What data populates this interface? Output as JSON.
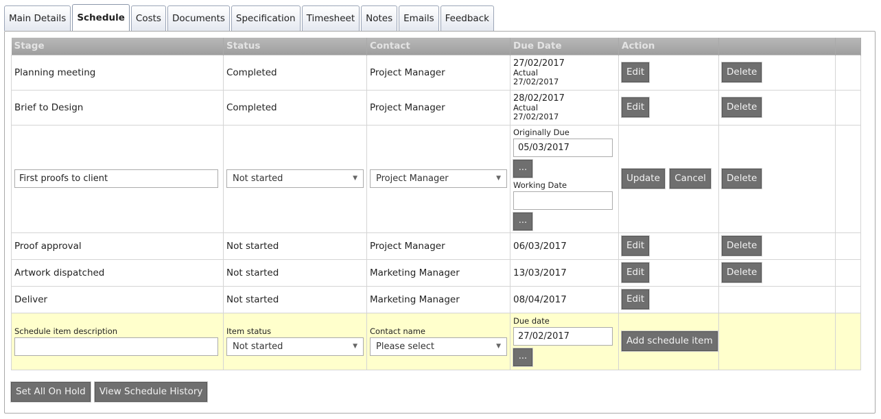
{
  "tabs": [
    "Main Details",
    "Schedule",
    "Costs",
    "Documents",
    "Specification",
    "Timesheet",
    "Notes",
    "Emails",
    "Feedback"
  ],
  "active_tab": "Schedule",
  "table": {
    "headers": {
      "stage": "Stage",
      "status": "Status",
      "contact": "Contact",
      "due_date": "Due Date",
      "action": "Action"
    },
    "rows": [
      {
        "stage": "Planning meeting",
        "status": "Completed",
        "contact": "Project Manager",
        "due": "27/02/2017",
        "actual_label": "Actual",
        "actual": "27/02/2017",
        "edit": "Edit",
        "delete": "Delete"
      },
      {
        "stage": "Brief to Design",
        "status": "Completed",
        "contact": "Project Manager",
        "due": "28/02/2017",
        "actual_label": "Actual",
        "actual": "27/02/2017",
        "edit": "Edit",
        "delete": "Delete"
      },
      {
        "stage": "Proof approval",
        "status": "Not started",
        "contact": "Project Manager",
        "due": "06/03/2017",
        "edit": "Edit",
        "delete": "Delete"
      },
      {
        "stage": "Artwork dispatched",
        "status": "Not started",
        "contact": "Marketing Manager",
        "due": "13/03/2017",
        "edit": "Edit",
        "delete": "Delete"
      },
      {
        "stage": "Deliver",
        "status": "Not started",
        "contact": "Marketing Manager",
        "due": "08/04/2017",
        "edit": "Edit"
      }
    ],
    "editing_row": {
      "stage_value": "First proofs to client",
      "status_value": "Not started",
      "contact_value": "Project Manager",
      "originally_due_label": "Originally Due",
      "originally_due_value": "05/03/2017",
      "working_date_label": "Working Date",
      "working_date_value": "",
      "dots_label": "...",
      "update_label": "Update",
      "cancel_label": "Cancel",
      "delete_label": "Delete"
    },
    "add_row": {
      "description_label": "Schedule item description",
      "description_value": "",
      "status_label": "Item status",
      "status_value": "Not started",
      "contact_label": "Contact name",
      "contact_value": "Please select",
      "due_label": "Due date",
      "due_value": "27/02/2017",
      "dots_label": "...",
      "add_label": "Add schedule item"
    }
  },
  "footer": {
    "hold_label": "Set All On Hold",
    "history_label": "View Schedule History"
  },
  "icons": {
    "dropdown_caret": "▼"
  },
  "colors": {
    "button_bg": "#6f6f6f",
    "header_bg": "#a8a8a8",
    "add_row_bg": "#ffffcc"
  }
}
